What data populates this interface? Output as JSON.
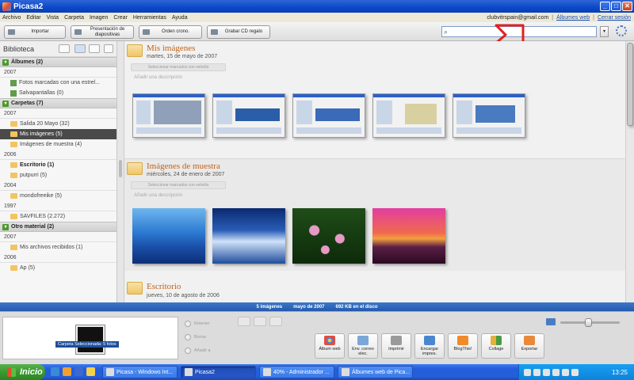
{
  "window": {
    "title": "Picasa2"
  },
  "menu": [
    "Archivo",
    "Editar",
    "Vista",
    "Carpeta",
    "Imagen",
    "Crear",
    "Herramientas",
    "Ayuda"
  ],
  "account": {
    "email": "clubvitrspain@gmail.com",
    "web_albums": "Álbumes web",
    "sign_out": "Cerrar sesión"
  },
  "toolbar": {
    "import": "Importar",
    "slideshow": "Presentación de diapositivas",
    "timeline": "Orden crono.",
    "burn_cd": "Grabar CD regalo"
  },
  "search": {
    "placeholder": ""
  },
  "sidebar": {
    "title": "Biblioteca",
    "groups": [
      {
        "label": "Álbumes (2)"
      },
      {
        "label": "Carpetas (7)"
      },
      {
        "label": "Otro material (2)"
      }
    ],
    "years": [
      "2007",
      "2007",
      "2006",
      "2004",
      "1997",
      "2007",
      "2006"
    ],
    "items": [
      "Fotos marcadas con una estrel...",
      "Salvapantallas (0)",
      "Salida 20 Mayo (32)",
      "Mis imágenes (5)",
      "Imágenes de muestra (4)",
      "Escritorio (1)",
      "putpurri (5)",
      "mondofreeike (5)",
      "SAVFILES (2.272)",
      "Mis archivos recibidos (1)",
      "Ap (5)"
    ]
  },
  "sections": [
    {
      "title": "Mis imágenes",
      "date": "martes, 15 de mayo de 2007",
      "star_button": "Seleccionar marcados con estrella",
      "description": "Añadir una descripción"
    },
    {
      "title": "Imágenes de muestra",
      "date": "miércoles, 24 de enero de 2007",
      "star_button": "Seleccionar marcados con estrella",
      "description": "Añadir una descripción"
    },
    {
      "title": "Escritorio",
      "date": "jueves, 10 de agosto de 2006"
    }
  ],
  "status": {
    "count": "5 imágenes",
    "date": "mayo de 2007",
    "size": "692 KB en el disco"
  },
  "tray": {
    "selection_label": "Carpeta Seleccionada: 5 fotos",
    "hold": "Retener",
    "clear": "Borrar",
    "add": "Añadir a",
    "actions": [
      "Álbum web",
      "Env. correo elec.",
      "Imprimir",
      "Encargar impres.",
      "BlogThis!",
      "Collage",
      "Exportar"
    ]
  },
  "taskbar": {
    "start": "Inicio",
    "tasks": [
      "Picasa - Windows Int...",
      "Picasa2",
      "40% - Administrador ...",
      "Álbumes web de Pica..."
    ],
    "clock": "13:25"
  },
  "colors": {
    "accent": "#c0621a",
    "annotation": "#e02020",
    "status_bar": "#2c64b8",
    "taskbar": "#245edb"
  }
}
